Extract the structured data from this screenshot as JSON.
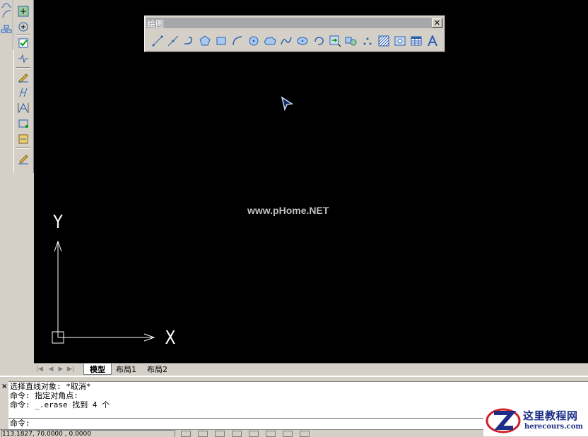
{
  "draw_toolbar": {
    "title": "绘图",
    "close_glyph": "✕",
    "tools": [
      "line-icon",
      "construction-line-icon",
      "polyline-icon",
      "polygon-icon",
      "rectangle-icon",
      "arc-icon",
      "circle-icon",
      "revision-cloud-icon",
      "spline-icon",
      "ellipse-icon",
      "ellipse-arc-icon",
      "insert-block-icon",
      "make-block-icon",
      "point-icon",
      "hatch-icon",
      "region-icon",
      "table-icon",
      "multiline-text-icon"
    ]
  },
  "canvas": {
    "watermark": "www.pHome.NET",
    "ucs": {
      "x_label": "X",
      "y_label": "Y"
    }
  },
  "layout_tabs": {
    "tabs": [
      "模型",
      "布局1",
      "布局2"
    ],
    "active": "模型"
  },
  "command_window": {
    "close_glyph": "×",
    "history": [
      "选择直线对象: *取消*",
      "命令: 指定对角点:",
      "命令: _.erase 找到 4 个"
    ],
    "prompt": "命令:"
  },
  "status_bar": {
    "coordinates": "113.1827, 70.0000 , 0.0000"
  },
  "logo": {
    "title": "这里教程网",
    "subtitle": "herecours.com"
  },
  "colors": {
    "canvas_background": "#000000",
    "ui_face": "#d4d0c8",
    "toolbar_icon_blue": "#2a5fb0",
    "logo_blue": "#1d2e86",
    "logo_red": "#d0202a"
  }
}
